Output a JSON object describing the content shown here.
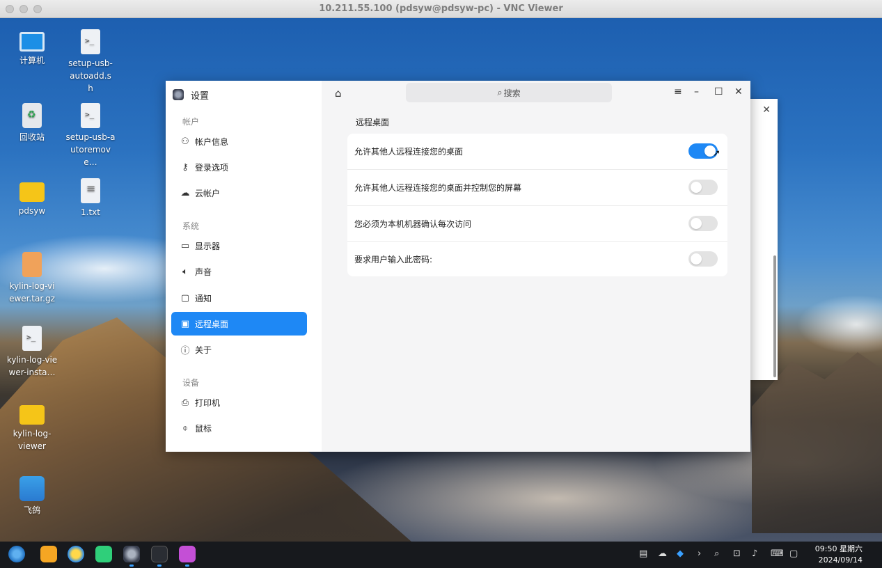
{
  "window": {
    "title": "10.211.55.100 (pdsyw@pdsyw-pc) - VNC Viewer"
  },
  "desktop_icons": [
    {
      "label": "计算机",
      "icon": "computer-icon"
    },
    {
      "label": "setup-usb-autoadd.sh",
      "icon": "script-file-icon"
    },
    {
      "label": "回收站",
      "icon": "trash-icon"
    },
    {
      "label": "setup-usb-autoremove…",
      "icon": "script-file-icon"
    },
    {
      "label": "pdsyw",
      "icon": "folder-icon"
    },
    {
      "label": "1.txt",
      "icon": "text-file-icon"
    },
    {
      "label": "kylin-log-viewer.tar.gz",
      "icon": "archive-icon"
    },
    {
      "label": "kylin-log-viewer-insta…",
      "icon": "script-file-icon"
    },
    {
      "label": "kylin-log-viewer",
      "icon": "folder-icon"
    },
    {
      "label": "飞鸽",
      "icon": "feige-app-icon"
    }
  ],
  "settings": {
    "app_title": "设置",
    "search_placeholder": "搜索",
    "groups": {
      "account": "帐户",
      "system": "系统",
      "device": "设备"
    },
    "nav": {
      "account_info": "帐户信息",
      "login_options": "登录选项",
      "cloud_account": "云帐户",
      "display": "显示器",
      "sound": "声音",
      "notify": "通知",
      "remote_desktop": "远程桌面",
      "about": "关于",
      "printer": "打印机",
      "mouse": "鼠标"
    },
    "page": {
      "section_title": "远程桌面",
      "rows": [
        {
          "label": "允许其他人远程连接您的桌面",
          "enabled": true
        },
        {
          "label": "允许其他人远程连接您的桌面并控制您的屏幕",
          "enabled": false
        },
        {
          "label": "您必须为本机机器确认每次访问",
          "enabled": false
        },
        {
          "label": "要求用户输入此密码:",
          "enabled": false
        }
      ]
    }
  },
  "taskbar": {
    "time": "09:50 星期六",
    "date": "2024/09/14"
  },
  "colors": {
    "accent": "#1e88f5",
    "taskbar": "#17191d"
  }
}
